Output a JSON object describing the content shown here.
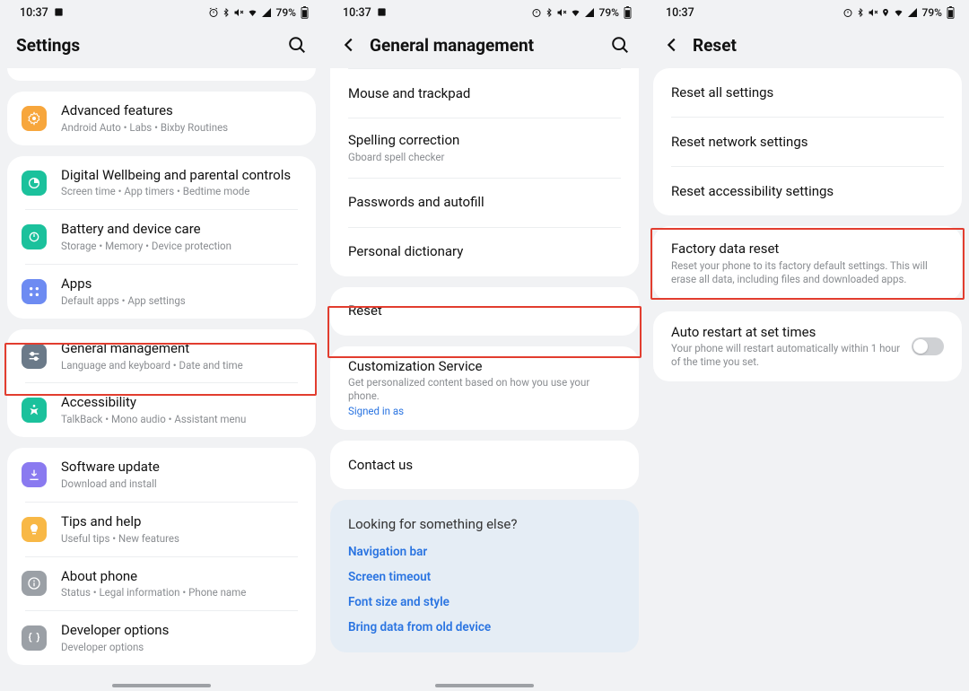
{
  "status": {
    "time": "10:37",
    "battery_text": "79%"
  },
  "screen1": {
    "title": "Settings",
    "rows": [
      {
        "title": "Advanced features",
        "sub": "Android Auto  •  Labs  •  Bixby Routines",
        "icon_bg": "#f7a63c"
      },
      {
        "title": "Digital Wellbeing and parental controls",
        "sub": "Screen time  •  App timers  •  Bedtime mode",
        "icon_bg": "#1bc19c"
      },
      {
        "title": "Battery and device care",
        "sub": "Storage  •  Memory  •  Device protection",
        "icon_bg": "#1bc19c"
      },
      {
        "title": "Apps",
        "sub": "Default apps  •  App settings",
        "icon_bg": "#6d8bf2"
      },
      {
        "title": "General management",
        "sub": "Language and keyboard  •  Date and time",
        "icon_bg": "#6b7a89"
      },
      {
        "title": "Accessibility",
        "sub": "TalkBack  •  Mono audio  •  Assistant menu",
        "icon_bg": "#1bc19c"
      },
      {
        "title": "Software update",
        "sub": "Download and install",
        "icon_bg": "#8a7af0"
      },
      {
        "title": "Tips and help",
        "sub": "Useful tips  •  New features",
        "icon_bg": "#f8b846"
      },
      {
        "title": "About phone",
        "sub": "Status  •  Legal information  •  Phone name",
        "icon_bg": "#9ba0a6"
      },
      {
        "title": "Developer options",
        "sub": "Developer options",
        "icon_bg": "#9ba0a6"
      }
    ]
  },
  "screen2": {
    "title": "General management",
    "group1": [
      {
        "title": "Mouse and trackpad"
      },
      {
        "title": "Spelling correction",
        "sub": "Gboard spell checker"
      },
      {
        "title": "Passwords and autofill"
      },
      {
        "title": "Personal dictionary"
      }
    ],
    "group2": [
      {
        "title": "Reset"
      }
    ],
    "group3": [
      {
        "title": "Customization Service",
        "sub": "Get personalized content based on how you use your phone.",
        "link": "Signed in as"
      }
    ],
    "group4": [
      {
        "title": "Contact us"
      }
    ],
    "looking_title": "Looking for something else?",
    "looking_links": [
      "Navigation bar",
      "Screen timeout",
      "Font size and style",
      "Bring data from old device"
    ]
  },
  "screen3": {
    "title": "Reset",
    "group1": [
      {
        "title": "Reset all settings"
      },
      {
        "title": "Reset network settings"
      },
      {
        "title": "Reset accessibility settings"
      }
    ],
    "group2": [
      {
        "title": "Factory data reset",
        "sub": "Reset your phone to its factory default settings. This will erase all data, including files and downloaded apps."
      }
    ],
    "group3": [
      {
        "title": "Auto restart at set times",
        "sub": "Your phone will restart automatically within 1 hour of the time you set."
      }
    ]
  }
}
